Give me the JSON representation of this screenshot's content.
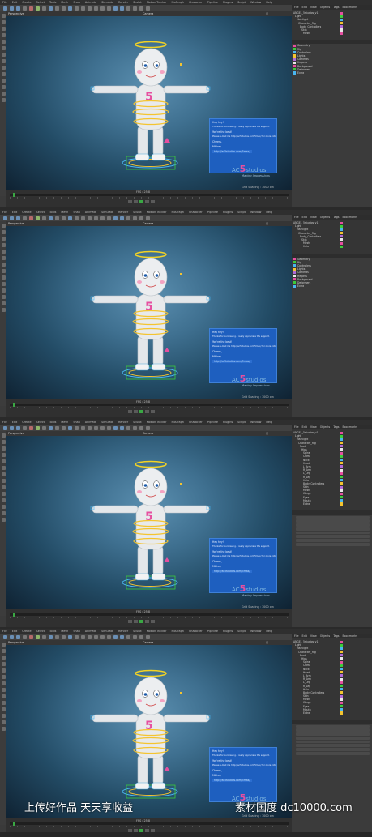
{
  "app": {
    "menu": [
      "File",
      "Edit",
      "Create",
      "Select",
      "Tools",
      "Mesh",
      "Snap",
      "Animate",
      "Simulate",
      "Render",
      "Sculpt",
      "Motion Tracker",
      "MoGraph",
      "Character",
      "Pipeline",
      "Plugins",
      "Script",
      "Window",
      "Help"
    ],
    "layout_label": "Layout:",
    "layout_value": "Startup (User)",
    "viewport_menu": [
      "View",
      "Cameras",
      "Display",
      "Options",
      "Filter",
      "Panel",
      "ProRender"
    ],
    "viewport_title": "Perspective",
    "camera_label": "Camera",
    "grid_spacing": "Grid Spacing : 1000 cm",
    "fps_label": "FPS : 25.8",
    "frames_label": "Frames : 0 F",
    "object_tabs": [
      "Objects",
      "Takes",
      "Content Browser",
      "Structure"
    ],
    "object_menu": [
      "File",
      "Edit",
      "View",
      "Objects",
      "Tags",
      "Bookmarks"
    ],
    "attr_tabs": [
      "Attributes",
      "Layers"
    ],
    "attr_menu": [
      "Mode",
      "Edit",
      "User Data"
    ]
  },
  "panels": [
    {
      "objects": [
        "ANGEL_5studios_v1",
        "Light",
        "Mainlight",
        "Character_Rig",
        "Body_Controllers",
        "Skin",
        "Mesh"
      ],
      "layers": [
        "Geometry",
        "Rig",
        "Controllers",
        "Lights",
        "Cameras",
        "Helpers",
        "Background",
        "Deformers",
        "Extra"
      ]
    },
    {
      "objects": [
        "ANGEL_5studios_v1",
        "Light",
        "Mainlight",
        "Character_Rig",
        "Body_Controllers",
        "Skin",
        "Mesh",
        "Halo"
      ],
      "layers": [
        "Geometry",
        "Rig",
        "Controllers",
        "Lights",
        "Cameras",
        "Helpers",
        "Background",
        "Deformers",
        "Extra"
      ]
    },
    {
      "objects": [
        "ANGEL_5studios_v1",
        "Light",
        "Mainlight",
        "Character_Rig",
        "Root",
        "Hips",
        "Spine",
        "Chest",
        "Neck",
        "Head",
        "L_Arm",
        "R_Arm",
        "L_Leg",
        "R_Leg",
        "Halo",
        "Body_Controllers",
        "Skin",
        "Mesh",
        "Wings",
        "Eyes",
        "Mouth",
        "Extra"
      ],
      "layers": []
    },
    {
      "objects": [
        "ANGEL_5studios_v1",
        "Light",
        "Mainlight",
        "Character_Rig",
        "Root",
        "Hips",
        "Spine",
        "Chest",
        "Neck",
        "Head",
        "L_Arm",
        "R_Arm",
        "L_Leg",
        "R_Leg",
        "Halo",
        "Body_Controllers",
        "Skin",
        "Mesh",
        "Wings",
        "Eyes",
        "Mouth",
        "Extra"
      ],
      "layers": []
    }
  ],
  "popup": {
    "greeting": "Hey hey!",
    "line1": "Thanks for purchasing. I really appreciate the support.",
    "line2": "You're the best!",
    "line3": "Please e-mail me http://ac5studios.com/5max/ for more info.",
    "signoff": "Cheers,",
    "name": "Mikhey",
    "link": "http://ac5studios.com/5max/"
  },
  "logo": {
    "prefix": "AC",
    "digit": "5",
    "suffix": "studios",
    "tagline": "Making Impressions"
  },
  "watermark": {
    "left": "上传好作品  天天享收益",
    "right": "素材国度  dc10000.com"
  },
  "colors": {
    "halo": "#f3d324",
    "rings": "#f4c430",
    "accent_pink": "#e64fa0",
    "controller_blue": "#49b6f0",
    "floor_green": "#3ccc3c",
    "popup_blue": "#1e5fbf"
  }
}
